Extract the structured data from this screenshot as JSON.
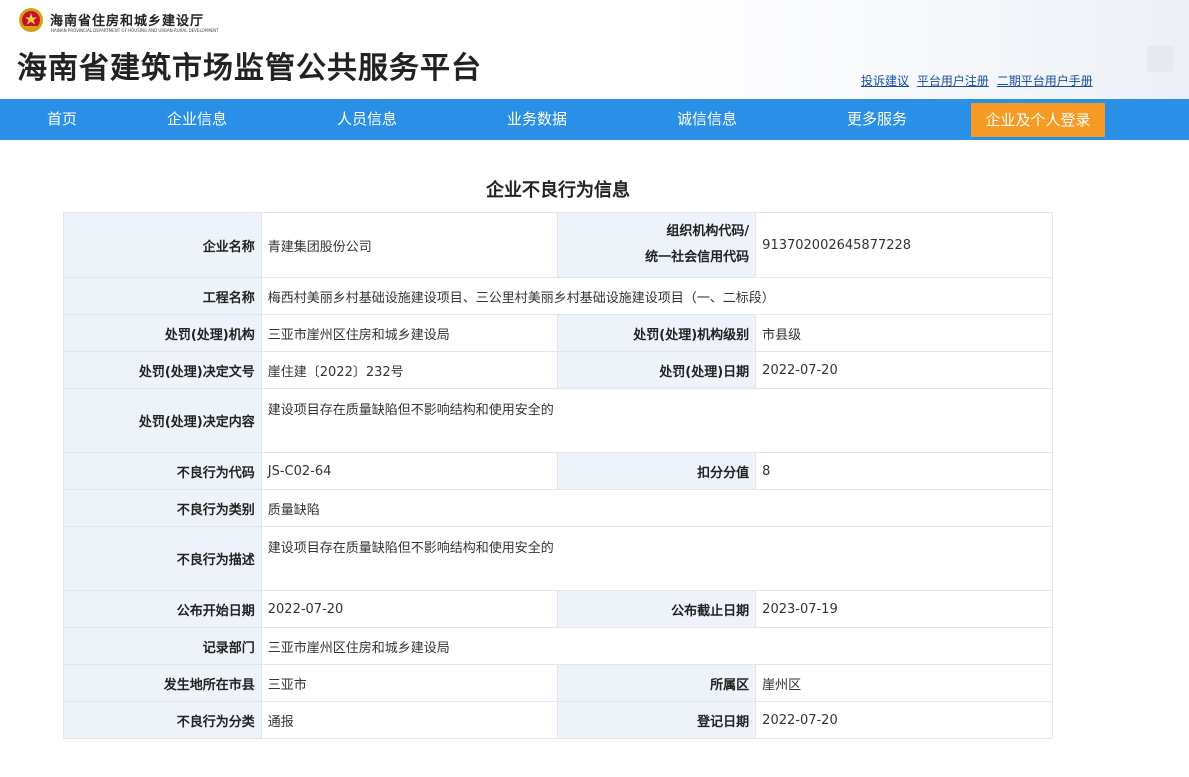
{
  "header": {
    "dept_name": "海南省住房和城乡建设厅",
    "dept_en": "HAINAN PROVINCIAL DEPARTMENT OF HOUSING AND URBAN-RURAL DEVELOPMENT",
    "site_title": "海南省建筑市场监管公共服务平台",
    "links": [
      "投诉建议",
      "平台用户注册",
      "二期平台用户手册"
    ]
  },
  "nav": {
    "items": [
      "首页",
      "企业信息",
      "人员信息",
      "业务数据",
      "诚信信息",
      "更多服务"
    ],
    "login": "企业及个人登录"
  },
  "colors": {
    "nav_bg": "#2a8fe6",
    "login_bg": "#f59a23",
    "label_bg": "#eef3f9"
  },
  "page_title": "企业不良行为信息",
  "record": {
    "company_label": "企业名称",
    "company": "青建集团股份公司",
    "org_code_label_1": "组织机构代码/",
    "org_code_label_2": "统一社会信用代码",
    "org_code": "913702002645877228",
    "project_label": "工程名称",
    "project": "梅西村美丽乡村基础设施建设项目、三公里村美丽乡村基础设施建设项目（一、二标段）",
    "agency_label": "处罚(处理)机构",
    "agency": "三亚市崖州区住房和城乡建设局",
    "agency_level_label": "处罚(处理)机构级别",
    "agency_level": "市县级",
    "doc_no_label": "处罚(处理)决定文号",
    "doc_no": "崖住建〔2022〕232号",
    "penalty_date_label": "处罚(处理)日期",
    "penalty_date": "2022-07-20",
    "decision_label": "处罚(处理)决定内容",
    "decision": "建设项目存在质量缺陷但不影响结构和使用安全的",
    "code_label": "不良行为代码",
    "code": "JS-C02-64",
    "score_label": "扣分分值",
    "score": "8",
    "category_label": "不良行为类别",
    "category": "质量缺陷",
    "desc_label": "不良行为描述",
    "desc": "建设项目存在质量缺陷但不影响结构和使用安全的",
    "pub_start_label": "公布开始日期",
    "pub_start": "2022-07-20",
    "pub_end_label": "公布截止日期",
    "pub_end": "2023-07-19",
    "dept_label": "记录部门",
    "dept": "三亚市崖州区住房和城乡建设局",
    "city_label": "发生地所在市县",
    "city": "三亚市",
    "district_label": "所属区",
    "district": "崖州区",
    "class_label": "不良行为分类",
    "class": "通报",
    "reg_date_label": "登记日期",
    "reg_date": "2022-07-20"
  }
}
